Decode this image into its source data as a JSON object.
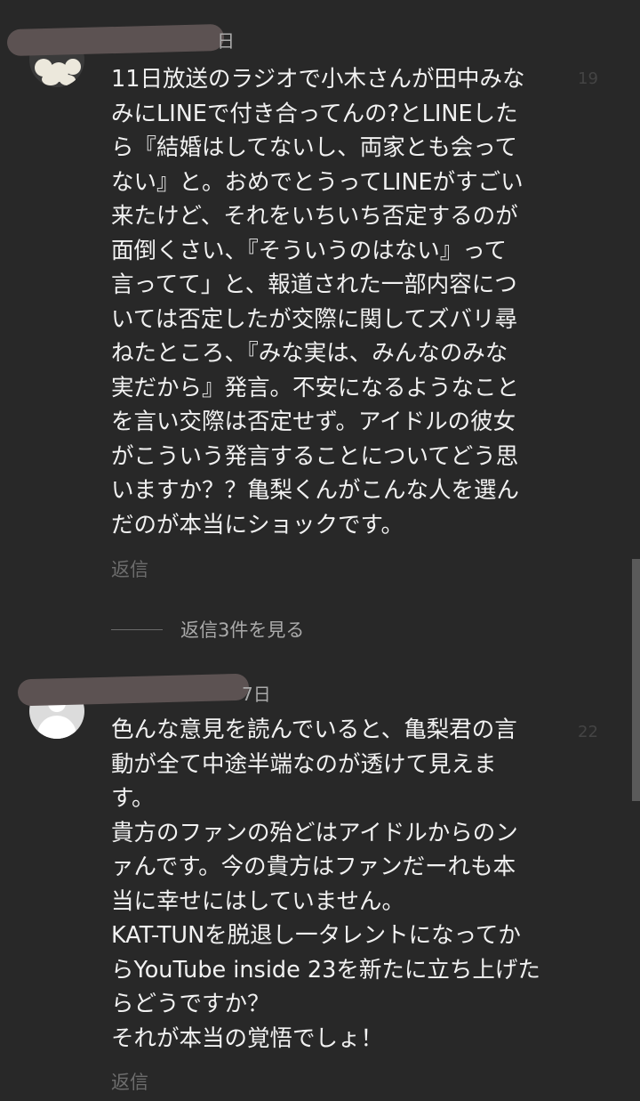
{
  "comments": [
    {
      "date_fragment": "日",
      "likes": "19",
      "lines": [
        "11日放送のラジオで小木さんが田中みな",
        "みにLINEで付き合ってんの?とLINEした",
        "ら『結婚はしてないし、両家とも会って",
        "ない』と。おめでとうってLINEがすごい",
        "来たけど、それをいちいち否定するのが",
        "面倒くさい、『そういうのはない』って",
        "言ってて」と、報道された一部内容につ",
        "いては否定したが交際に関してズバリ尋",
        "ねたところ、『みな実は、みんなのみな",
        "実だから』発言。不安になるようなこと",
        "を言い交際は否定せず。アイドルの彼女",
        "がこういう発言することについてどう思",
        "いますか？？亀梨くんがこんな人を選ん",
        "だのが本当にショックです。"
      ],
      "reply_label": "返信",
      "view_replies_label": "返信3件を見る"
    },
    {
      "date_fragment": "7日",
      "likes": "22",
      "lines": [
        "色んな意見を読んでいると、亀梨君の言",
        "動が全て中途半端なのが透けて見えま",
        "す。",
        "貴方のファンの殆どはアイドルからのン",
        "ァんです。今の貴方はファンだーれも本",
        "当に幸せにはしていません。",
        "KAT-TUNを脱退し一タレントになってか",
        "らYouTube inside 23を新たに立ち上げた",
        "らどうですか？",
        "それが本当の覚悟でしょ！"
      ],
      "reply_label": "返信"
    }
  ],
  "colors": {
    "background": "#282828",
    "text": "#f1f1f1",
    "secondary": "#aaaaaa",
    "reply": "#6d6d6d",
    "redaction": "#5c5252"
  },
  "icons": {
    "avatar_1": "food-photo-avatar",
    "avatar_2": "default-user-avatar"
  }
}
